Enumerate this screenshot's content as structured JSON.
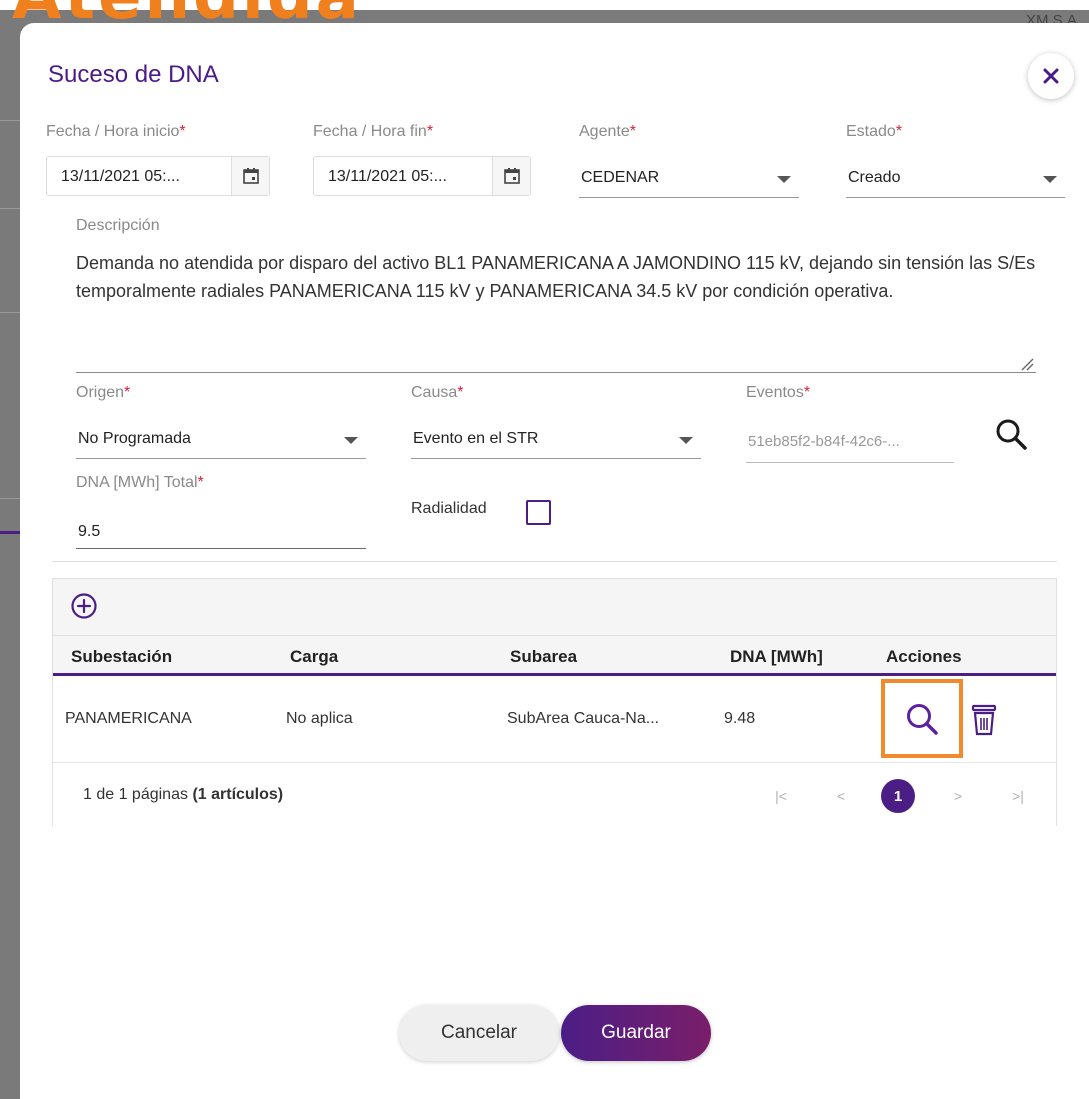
{
  "background": {
    "title": "Atendida",
    "user_label": "XM S.A."
  },
  "modal": {
    "title": "Suceso de DNA",
    "close_icon": "close-icon"
  },
  "fields": {
    "fecha_inicio": {
      "label": "Fecha / Hora inicio",
      "required": "*",
      "value": "13/11/2021 05:..."
    },
    "fecha_fin": {
      "label": "Fecha / Hora fin",
      "required": "*",
      "value": "13/11/2021 05:..."
    },
    "agente": {
      "label": "Agente",
      "required": "*",
      "value": "CEDENAR"
    },
    "estado": {
      "label": "Estado",
      "required": "*",
      "value": "Creado"
    },
    "descripcion": {
      "label": "Descripción",
      "value": "Demanda no atendida por disparo del activo BL1 PANAMERICANA A JAMONDINO 115 kV, dejando sin tensión las S/Es temporalmente radiales PANAMERICANA 115 kV y PANAMERICANA 34.5 kV por condición operativa."
    },
    "origen": {
      "label": "Origen",
      "required": "*",
      "value": "No Programada"
    },
    "causa": {
      "label": "Causa",
      "required": "*",
      "value": "Evento en el STR"
    },
    "eventos": {
      "label": "Eventos",
      "required": "*",
      "value": "51eb85f2-b84f-42c6-..."
    },
    "dna_total": {
      "label": "DNA [MWh] Total",
      "required": "*",
      "value": "9.5"
    },
    "radialidad": {
      "label": "Radialidad",
      "checked": false
    }
  },
  "grid": {
    "columns": [
      "Subestación",
      "Carga",
      "Subarea",
      "DNA [MWh]",
      "Acciones"
    ],
    "rows": [
      {
        "subestacion": "PANAMERICANA",
        "carga": "No aplica",
        "subarea": "SubArea Cauca-Na...",
        "dna": "9.48"
      }
    ],
    "pager": {
      "summary": "1 de 1 páginas",
      "items": "(1 artículos)",
      "current_page": "1",
      "first": "|<",
      "prev": "<",
      "next": ">",
      "last": ">|"
    },
    "highlight_color": "#f08a2c"
  },
  "footer": {
    "cancel_label": "Cancelar",
    "save_label": "Guardar"
  },
  "colors": {
    "accent": "#4b1e86",
    "required": "#d6233a",
    "highlight": "#f08a2c"
  }
}
